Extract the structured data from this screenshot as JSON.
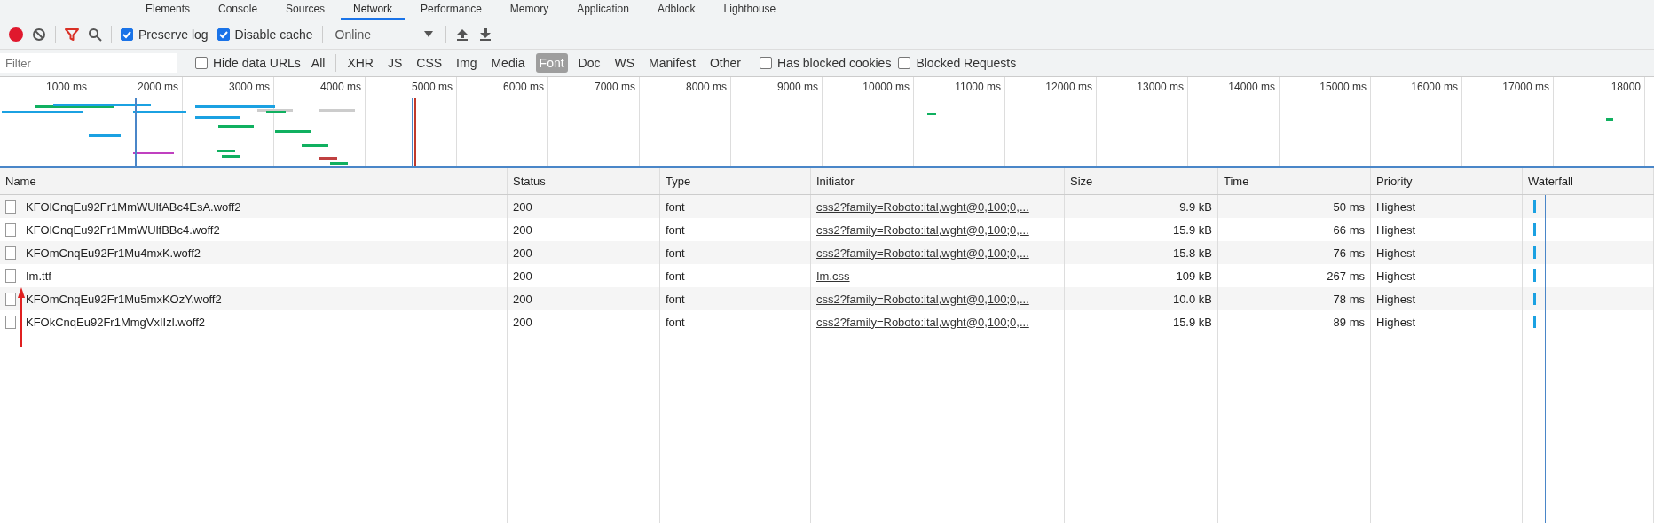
{
  "tabs": [
    {
      "label": "Elements",
      "selected": false
    },
    {
      "label": "Console",
      "selected": false
    },
    {
      "label": "Sources",
      "selected": false
    },
    {
      "label": "Network",
      "selected": true
    },
    {
      "label": "Performance",
      "selected": false
    },
    {
      "label": "Memory",
      "selected": false
    },
    {
      "label": "Application",
      "selected": false
    },
    {
      "label": "Adblock",
      "selected": false
    },
    {
      "label": "Lighthouse",
      "selected": false
    }
  ],
  "toolbar": {
    "recording": true,
    "filter_active": true,
    "checkboxes": [
      {
        "label": "Preserve log",
        "checked": true
      },
      {
        "label": "Disable cache",
        "checked": true
      }
    ],
    "throttling": "Online"
  },
  "filter_bar": {
    "placeholder": "Filter",
    "hide_data_urls": {
      "label": "Hide data URLs",
      "checked": false
    },
    "types": [
      {
        "label": "All",
        "selected": false
      },
      {
        "label": "XHR",
        "selected": false
      },
      {
        "label": "JS",
        "selected": false
      },
      {
        "label": "CSS",
        "selected": false
      },
      {
        "label": "Img",
        "selected": false
      },
      {
        "label": "Media",
        "selected": false
      },
      {
        "label": "Font",
        "selected": true
      },
      {
        "label": "Doc",
        "selected": false
      },
      {
        "label": "WS",
        "selected": false
      },
      {
        "label": "Manifest",
        "selected": false
      },
      {
        "label": "Other",
        "selected": false
      }
    ],
    "extra": [
      {
        "label": "Has blocked cookies",
        "checked": false
      },
      {
        "label": "Blocked Requests",
        "checked": false
      }
    ]
  },
  "overview": {
    "ticks": [
      "1000 ms",
      "2000 ms",
      "3000 ms",
      "4000 ms",
      "5000 ms",
      "6000 ms",
      "7000 ms",
      "8000 ms",
      "9000 ms",
      "10000 ms",
      "11000 ms",
      "12000 ms",
      "13000 ms",
      "14000 ms",
      "15000 ms",
      "16000 ms",
      "17000 ms",
      "18000"
    ]
  },
  "table": {
    "columns": [
      "Name",
      "Status",
      "Type",
      "Initiator",
      "Size",
      "Time",
      "Priority",
      "Waterfall"
    ],
    "rows": [
      {
        "name": "KFOlCnqEu92Fr1MmWUlfABc4EsA.woff2",
        "status": "200",
        "type": "font",
        "initiator": "css2?family=Roboto:ital,wght@0,100;0,...",
        "size": "9.9 kB",
        "time": "50 ms",
        "priority": "Highest"
      },
      {
        "name": "KFOlCnqEu92Fr1MmWUlfBBc4.woff2",
        "status": "200",
        "type": "font",
        "initiator": "css2?family=Roboto:ital,wght@0,100;0,...",
        "size": "15.9 kB",
        "time": "66 ms",
        "priority": "Highest"
      },
      {
        "name": "KFOmCnqEu92Fr1Mu4mxK.woff2",
        "status": "200",
        "type": "font",
        "initiator": "css2?family=Roboto:ital,wght@0,100;0,...",
        "size": "15.8 kB",
        "time": "76 ms",
        "priority": "Highest"
      },
      {
        "name": "Im.ttf",
        "status": "200",
        "type": "font",
        "initiator": "Im.css",
        "size": "109 kB",
        "time": "267 ms",
        "priority": "Highest"
      },
      {
        "name": "KFOmCnqEu92Fr1Mu5mxKOzY.woff2",
        "status": "200",
        "type": "font",
        "initiator": "css2?family=Roboto:ital,wght@0,100;0,...",
        "size": "10.0 kB",
        "time": "78 ms",
        "priority": "Highest"
      },
      {
        "name": "KFOkCnqEu92Fr1MmgVxIIzl.woff2",
        "status": "200",
        "type": "font",
        "initiator": "css2?family=Roboto:ital,wght@0,100;0,...",
        "size": "15.9 kB",
        "time": "89 ms",
        "priority": "Highest"
      }
    ]
  }
}
